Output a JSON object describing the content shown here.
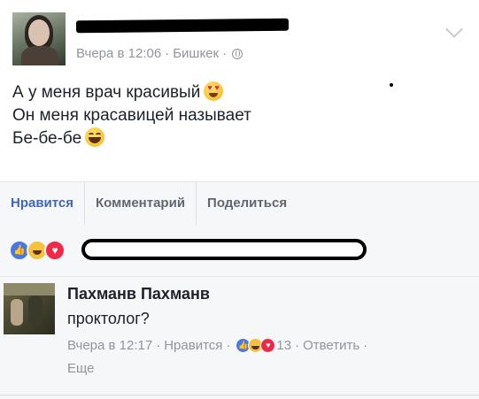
{
  "post": {
    "timestamp": "Вчера в 12:06",
    "location": "Бишкек",
    "privacy_icon": "globe-icon",
    "lines": [
      "А у меня врач красивый",
      "Он меня красавицей называет",
      "Бе-бе-бе"
    ],
    "line_emojis": [
      "heart-eyes-emoji",
      "",
      "laughing-emoji"
    ]
  },
  "actions": {
    "like": "Нравится",
    "comment": "Комментарий",
    "share": "Поделиться"
  },
  "reactions": {
    "icons": [
      "like-icon",
      "haha-icon",
      "love-icon"
    ],
    "like_glyph": "👍",
    "love_glyph": "♥"
  },
  "comment": {
    "author": "Пахманв Пахманв",
    "text": "проктолог?",
    "timestamp": "Вчера в 12:17",
    "like_label": "Нравится",
    "reaction_count": "13",
    "reply_label": "Ответить",
    "more_label": "Еще",
    "separator": "·"
  },
  "colors": {
    "accent": "#4267b2",
    "meta_text": "#90949c",
    "action_text": "#606770",
    "bar_bg": "#f6f7f9"
  }
}
